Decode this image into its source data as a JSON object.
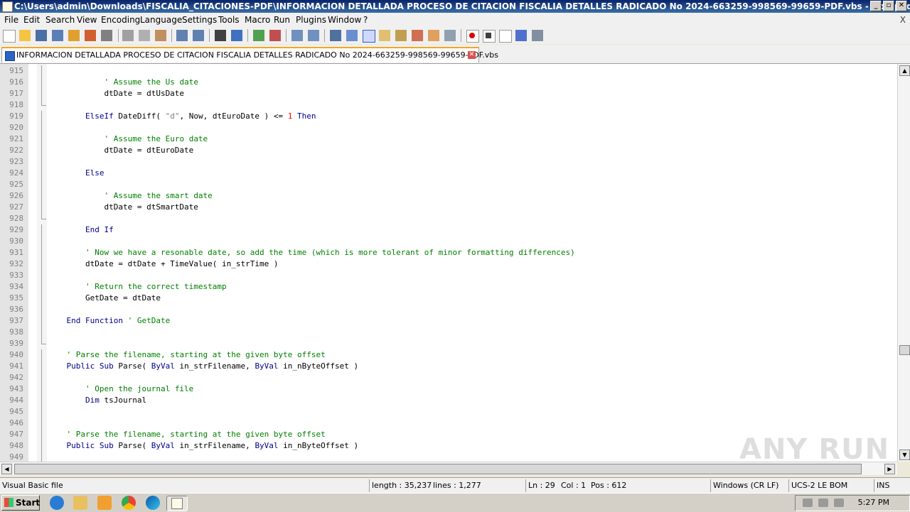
{
  "window": {
    "title": "C:\\Users\\admin\\Downloads\\FISCALIA_CITACIONES-PDF\\INFORMACION DETALLADA PROCESO DE CITACION FISCALIA DETALLES RADICADO No 2024-663259-998569-99659-PDF.vbs - Notepad++",
    "min": "_",
    "max": "▫",
    "close": "✕"
  },
  "menu": {
    "items": [
      "File",
      "Edit",
      "Search",
      "View",
      "Encoding",
      "Language",
      "Settings",
      "Tools",
      "Macro",
      "Run",
      "Plugins",
      "Window",
      "?"
    ],
    "close_doc": "X"
  },
  "tab": {
    "label": "INFORMACION DETALLADA PROCESO DE CITACION FISCALIA DETALLES RADICADO No 2024-663259-998569-99659-PDF.vbs",
    "close": "✕"
  },
  "editor": {
    "lines": [
      {
        "n": "915",
        "code": []
      },
      {
        "n": "916",
        "code": [
          {
            "t": "            "
          },
          {
            "t": "' Assume the Us date",
            "c": "cm"
          }
        ]
      },
      {
        "n": "917",
        "code": [
          {
            "t": "            dtDate = dtUsDate"
          }
        ]
      },
      {
        "n": "918",
        "code": []
      },
      {
        "n": "919",
        "code": [
          {
            "t": "        "
          },
          {
            "t": "ElseIf",
            "c": "kw"
          },
          {
            "t": " DateDiff( "
          },
          {
            "t": "\"d\"",
            "c": "st"
          },
          {
            "t": ", Now, dtEuroDate ) <= "
          },
          {
            "t": "1",
            "c": "nm"
          },
          {
            "t": " "
          },
          {
            "t": "Then",
            "c": "kw"
          }
        ]
      },
      {
        "n": "920",
        "code": []
      },
      {
        "n": "921",
        "code": [
          {
            "t": "            "
          },
          {
            "t": "' Assume the Euro date",
            "c": "cm"
          }
        ]
      },
      {
        "n": "922",
        "code": [
          {
            "t": "            dtDate = dtEuroDate"
          }
        ]
      },
      {
        "n": "923",
        "code": []
      },
      {
        "n": "924",
        "code": [
          {
            "t": "        "
          },
          {
            "t": "Else",
            "c": "kw"
          }
        ]
      },
      {
        "n": "925",
        "code": []
      },
      {
        "n": "926",
        "code": [
          {
            "t": "            "
          },
          {
            "t": "' Assume the smart date",
            "c": "cm"
          }
        ]
      },
      {
        "n": "927",
        "code": [
          {
            "t": "            dtDate = dtSmartDate"
          }
        ]
      },
      {
        "n": "928",
        "code": []
      },
      {
        "n": "929",
        "code": [
          {
            "t": "        "
          },
          {
            "t": "End If",
            "c": "kw"
          }
        ]
      },
      {
        "n": "930",
        "code": []
      },
      {
        "n": "931",
        "code": [
          {
            "t": "        "
          },
          {
            "t": "' Now we have a resonable date, so add the time (which is more tolerant of minor formatting differences)",
            "c": "cm"
          }
        ]
      },
      {
        "n": "932",
        "code": [
          {
            "t": "        dtDate = dtDate + TimeValue( in_strTime )"
          }
        ]
      },
      {
        "n": "933",
        "code": []
      },
      {
        "n": "934",
        "code": [
          {
            "t": "        "
          },
          {
            "t": "' Return the correct timestamp",
            "c": "cm"
          }
        ]
      },
      {
        "n": "935",
        "code": [
          {
            "t": "        GetDate = dtDate"
          }
        ]
      },
      {
        "n": "936",
        "code": []
      },
      {
        "n": "937",
        "code": [
          {
            "t": "    "
          },
          {
            "t": "End Function",
            "c": "kw"
          },
          {
            "t": " "
          },
          {
            "t": "' GetDate",
            "c": "cm"
          }
        ]
      },
      {
        "n": "938",
        "code": []
      },
      {
        "n": "939",
        "code": []
      },
      {
        "n": "940",
        "code": [
          {
            "t": "    "
          },
          {
            "t": "' Parse the filename, starting at the given byte offset",
            "c": "cm"
          }
        ]
      },
      {
        "n": "941",
        "code": [
          {
            "t": "    "
          },
          {
            "t": "Public Sub",
            "c": "kw"
          },
          {
            "t": " Parse( "
          },
          {
            "t": "ByVal",
            "c": "kw"
          },
          {
            "t": " in_strFilename, "
          },
          {
            "t": "ByVal",
            "c": "kw"
          },
          {
            "t": " in_nByteOffset )"
          }
        ]
      },
      {
        "n": "942",
        "code": []
      },
      {
        "n": "943",
        "code": [
          {
            "t": "        "
          },
          {
            "t": "' Open the journal file",
            "c": "cm"
          }
        ]
      },
      {
        "n": "944",
        "code": [
          {
            "t": "        "
          },
          {
            "t": "Dim",
            "c": "kw"
          },
          {
            "t": " tsJournal"
          }
        ]
      },
      {
        "n": "945",
        "code": []
      },
      {
        "n": "946",
        "code": []
      },
      {
        "n": "947",
        "code": [
          {
            "t": "    "
          },
          {
            "t": "' Parse the filename, starting at the given byte offset",
            "c": "cm"
          }
        ]
      },
      {
        "n": "948",
        "code": [
          {
            "t": "    "
          },
          {
            "t": "Public Sub",
            "c": "kw"
          },
          {
            "t": " Parse( "
          },
          {
            "t": "ByVal",
            "c": "kw"
          },
          {
            "t": " in_strFilename, "
          },
          {
            "t": "ByVal",
            "c": "kw"
          },
          {
            "t": " in_nByteOffset )"
          }
        ]
      },
      {
        "n": "949",
        "code": []
      }
    ]
  },
  "watermark": "ANY RUN",
  "status": {
    "file_type": "Visual Basic file",
    "length": "length : 35,237",
    "lines": "lines : 1,277",
    "ln": "Ln : 29",
    "col": "Col : 1",
    "pos": "Pos : 612",
    "eol": "Windows (CR LF)",
    "encoding": "UCS-2 LE BOM",
    "mode": "INS"
  },
  "taskbar": {
    "start": "Start",
    "clock": "5:27 PM"
  },
  "colors": {
    "keyword": "#00008b",
    "comment": "#008000",
    "string": "#808080",
    "number": "#ff0000"
  }
}
